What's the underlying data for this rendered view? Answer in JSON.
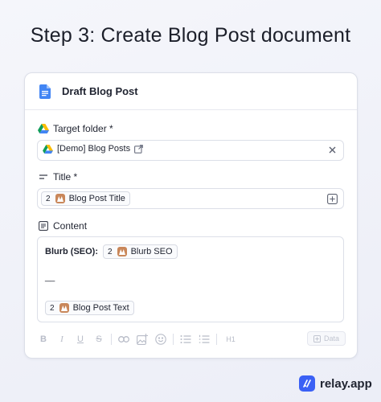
{
  "headline": "Step 3: Create Blog Post document",
  "card": {
    "title": "Draft Blog Post",
    "target_folder": {
      "label": "Target folder *",
      "value": "[Demo] Blog Posts"
    },
    "title_field": {
      "label": "Title *",
      "token_step": "2",
      "token_label": "Blog Post Title"
    },
    "content": {
      "label": "Content",
      "blurb_label": "Blurb (SEO):",
      "blurb_token_step": "2",
      "blurb_token_label": "Blurb SEO",
      "separator": "__",
      "text_token_step": "2",
      "text_token_label": "Blog Post Text"
    },
    "toolbar": {
      "bold": "B",
      "italic": "I",
      "underline": "U",
      "strike": "S",
      "heading": "H1",
      "data_button": "Data"
    }
  },
  "brand": "relay.app",
  "colors": {
    "accent": "#3a60f5",
    "token_icon": "#c9875a",
    "doc_icon": "#4285f4"
  }
}
